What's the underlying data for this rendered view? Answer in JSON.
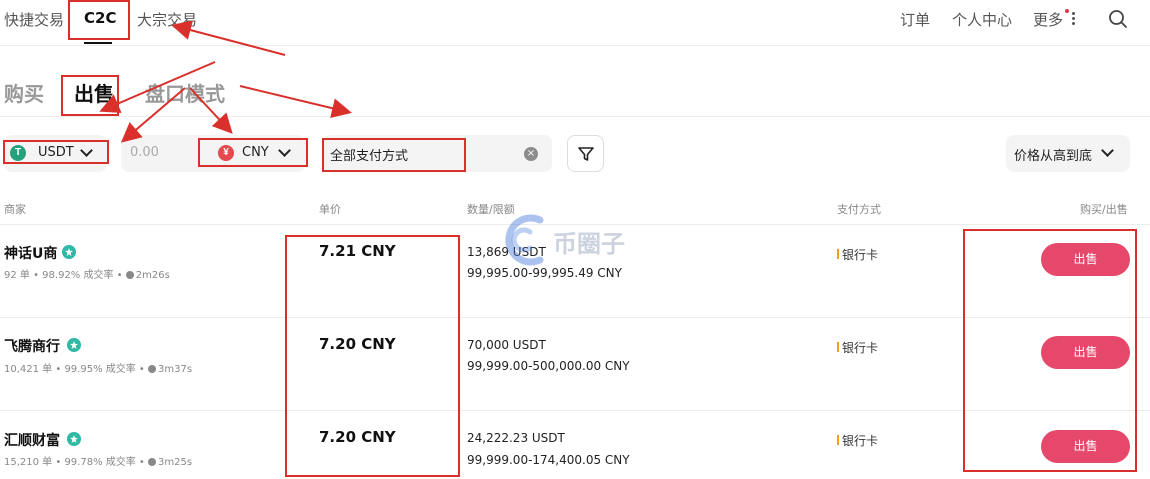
{
  "nav": {
    "tabs": [
      "快捷交易",
      "C2C",
      "大宗交易"
    ],
    "right": {
      "orders": "订单",
      "account": "个人中心",
      "more": "更多"
    }
  },
  "mode_tabs": [
    "购买",
    "出售",
    "盘口模式"
  ],
  "filters": {
    "asset": "USDT",
    "amount_placeholder": "0.00",
    "fiat": "CNY",
    "payment": "全部支付方式",
    "sort": "价格从高到底",
    "coin_icons": {
      "usdt": "T",
      "cny": "¥"
    }
  },
  "table": {
    "headers": [
      "商家",
      "单价",
      "数量/限额",
      "支付方式",
      "购买/出售"
    ],
    "rows": [
      {
        "name": "神话U商",
        "orders": "92 单",
        "completion": "98.92% 成交率",
        "time": "2m26s",
        "price": "7.21 CNY",
        "quantity": "13,869 USDT",
        "limit": "99,995.00-99,995.49 CNY",
        "payment": "银行卡",
        "action": "出售"
      },
      {
        "name": "飞腾商行",
        "orders": "10,421 单",
        "completion": "99.95% 成交率",
        "time": "3m37s",
        "price": "7.20 CNY",
        "quantity": "70,000 USDT",
        "limit": "99,999.00-500,000.00 CNY",
        "payment": "银行卡",
        "action": "出售"
      },
      {
        "name": "汇顺财富",
        "orders": "15,210 单",
        "completion": "99.78% 成交率",
        "time": "3m25s",
        "price": "7.20 CNY",
        "quantity": "24,222.23 USDT",
        "limit": "99,999.00-174,400.05 CNY",
        "payment": "银行卡",
        "action": "出售"
      }
    ]
  },
  "watermark": "币圈子",
  "colors": {
    "accent_sell": "#e5486a",
    "verified": "#2fb9a5",
    "annotation": "#d9302c",
    "usdt": "#26a17b",
    "cny": "#e5484d"
  }
}
